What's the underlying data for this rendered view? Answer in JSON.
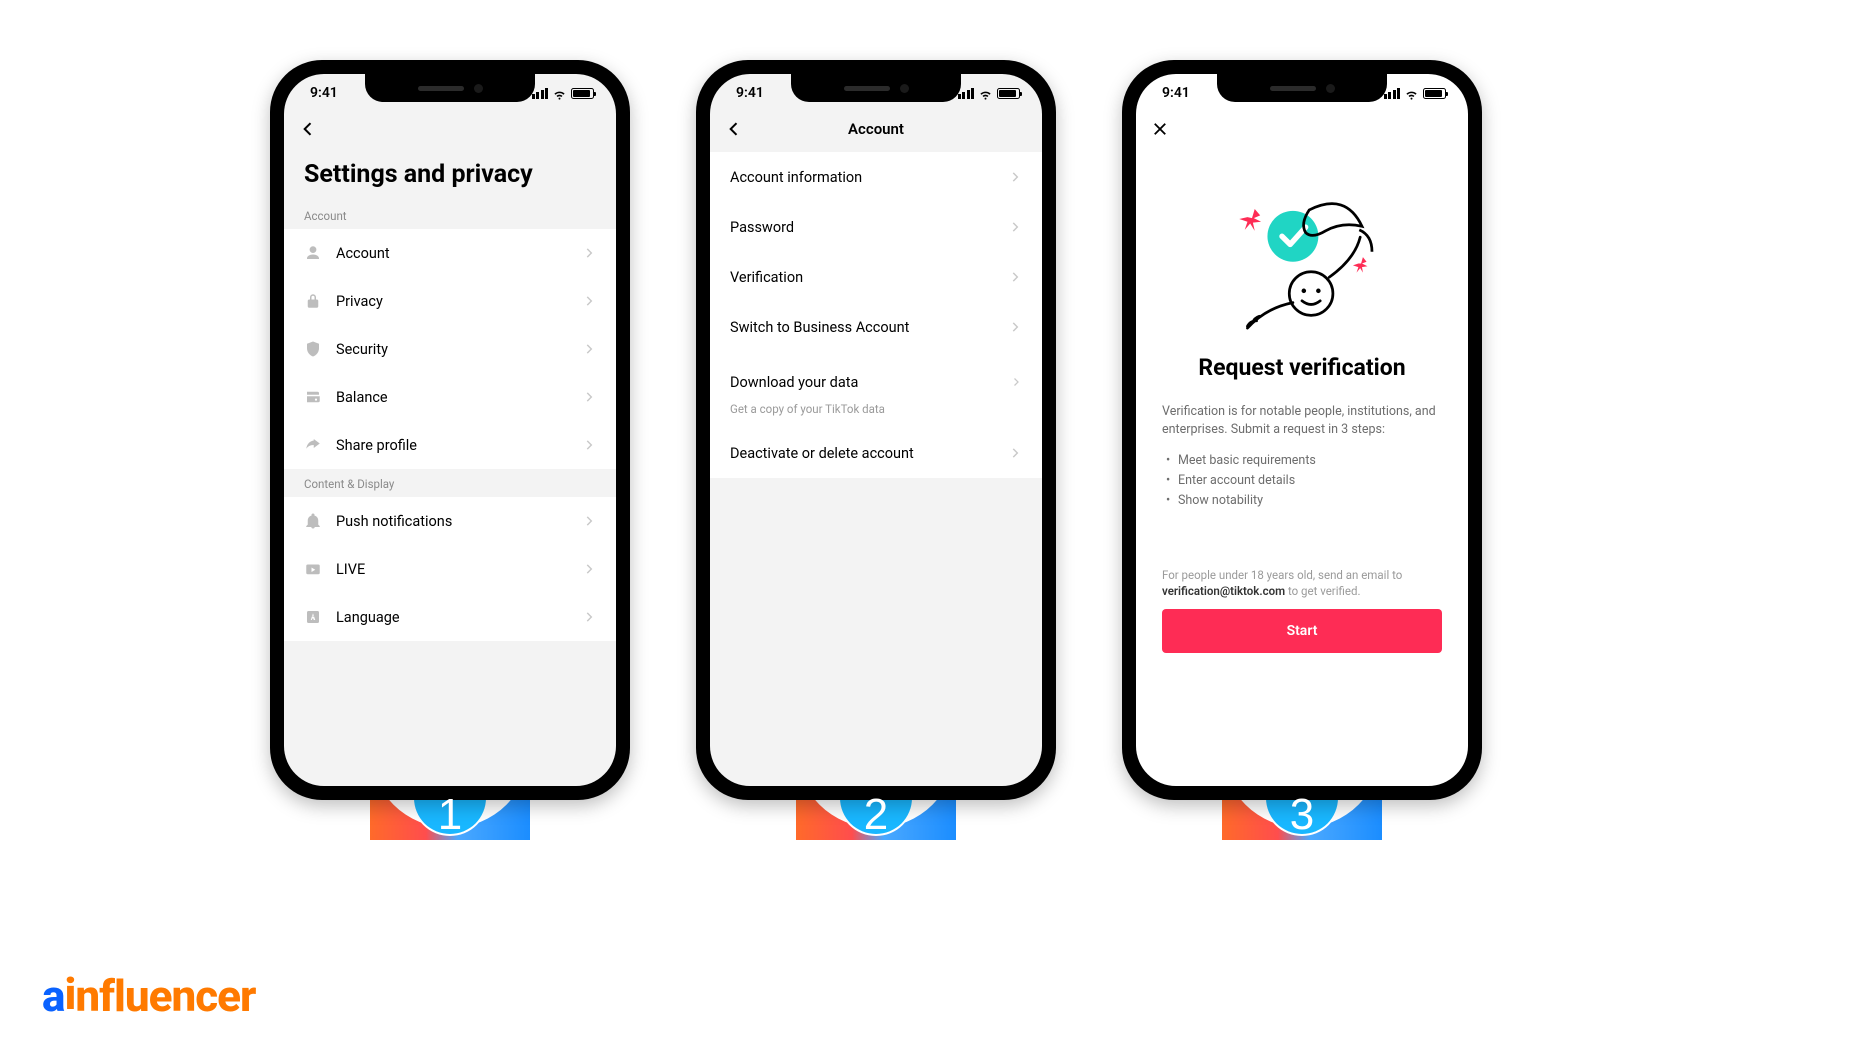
{
  "status": {
    "time": "9:41"
  },
  "screen1": {
    "page_title": "Settings and privacy",
    "section_account": "Account",
    "section_content": "Content & Display",
    "items_account": [
      {
        "label": "Account"
      },
      {
        "label": "Privacy"
      },
      {
        "label": "Security"
      },
      {
        "label": "Balance"
      },
      {
        "label": "Share profile"
      }
    ],
    "items_content": [
      {
        "label": "Push notifications"
      },
      {
        "label": "LIVE"
      },
      {
        "label": "Language"
      }
    ]
  },
  "screen2": {
    "header_title": "Account",
    "items": [
      {
        "label": "Account information",
        "sub": ""
      },
      {
        "label": "Password",
        "sub": ""
      },
      {
        "label": "Verification",
        "sub": ""
      },
      {
        "label": "Switch to Business Account",
        "sub": ""
      },
      {
        "label": "Download your data",
        "sub": "Get a copy of your TikTok data"
      },
      {
        "label": "Deactivate or delete account",
        "sub": ""
      }
    ]
  },
  "screen3": {
    "title": "Request verification",
    "desc": "Verification is for notable people, institutions, and enterprises. Submit a request in 3 steps:",
    "bullets": [
      "Meet basic requirements",
      "Enter account details",
      "Show notability"
    ],
    "under18_a": "For people under 18 years old, send an email to ",
    "under18_b": "verification@tiktok.com",
    "under18_c": " to get verified.",
    "start": "Start"
  },
  "steps": [
    "1",
    "2",
    "3"
  ],
  "brand": {
    "a": "a",
    "i": "i",
    "rest": "nfluencer"
  }
}
